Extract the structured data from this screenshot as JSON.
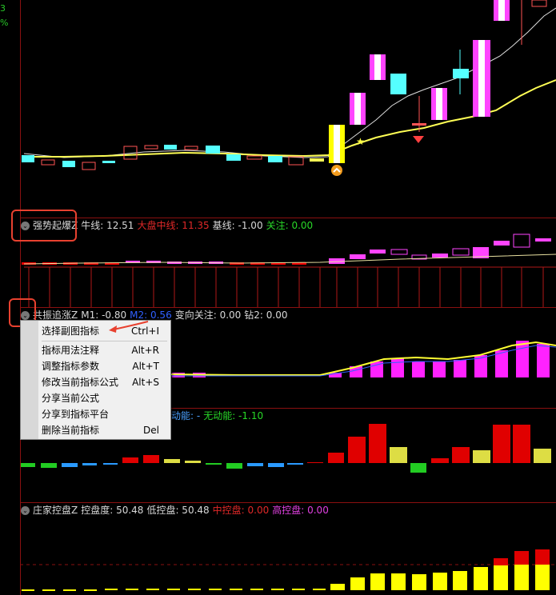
{
  "left_labels": [
    "3",
    "%"
  ],
  "pane1": {
    "name": "强势起爆Z",
    "items": [
      {
        "label": "牛线: 12.51",
        "color": "#d8d8d8"
      },
      {
        "label": "大盘中线: 11.35",
        "color": "#e02828"
      },
      {
        "label": "基线: -1.00",
        "color": "#d8d8d8"
      },
      {
        "label": "关注: 0.00",
        "color": "#28d828"
      }
    ]
  },
  "pane2": {
    "name": "共振追涨Z",
    "items": [
      {
        "label": "M1: -0.80",
        "color": "#d8d8d8"
      },
      {
        "label": "M2: 0.56",
        "color": "#3060ff"
      },
      {
        "label": "变向关注: 0.00",
        "color": "#d8d8d8"
      },
      {
        "label": "钻2: 0.00",
        "color": "#d8d8d8"
      }
    ]
  },
  "pane3": {
    "items": [
      {
        "label": "动能: -",
        "color": "#4aa0ff"
      },
      {
        "label": "无动能: -1.10",
        "color": "#28d828"
      }
    ]
  },
  "pane4": {
    "name": "庄家控盘Z",
    "items": [
      {
        "label": "控盘度: 50.48",
        "color": "#d8d8d8"
      },
      {
        "label": "低控盘: 50.48",
        "color": "#d8d8d8"
      },
      {
        "label": "中控盘: 0.00",
        "color": "#e02828"
      },
      {
        "label": "高控盘: 0.00",
        "color": "#e040e0"
      }
    ]
  },
  "context_menu": {
    "items": [
      {
        "label": "选择副图指标",
        "shortcut": "Ctrl+I"
      },
      {
        "label": "指标用法注释",
        "shortcut": "Alt+R"
      },
      {
        "label": "调整指标参数",
        "shortcut": "Alt+T"
      },
      {
        "label": "修改当前指标公式",
        "shortcut": "Alt+S"
      },
      {
        "label": "分享当前公式",
        "shortcut": ""
      },
      {
        "label": "分享到指标平台",
        "shortcut": ""
      },
      {
        "label": "删除当前指标",
        "shortcut": "Del"
      }
    ]
  },
  "colors": {
    "up": "#ff44ff",
    "down": "#55ffff",
    "yellow": "#ffff33",
    "red": "#e00000",
    "green": "#22cc22",
    "grid_red": "#8a1010",
    "highlight": "#e8412f"
  }
}
